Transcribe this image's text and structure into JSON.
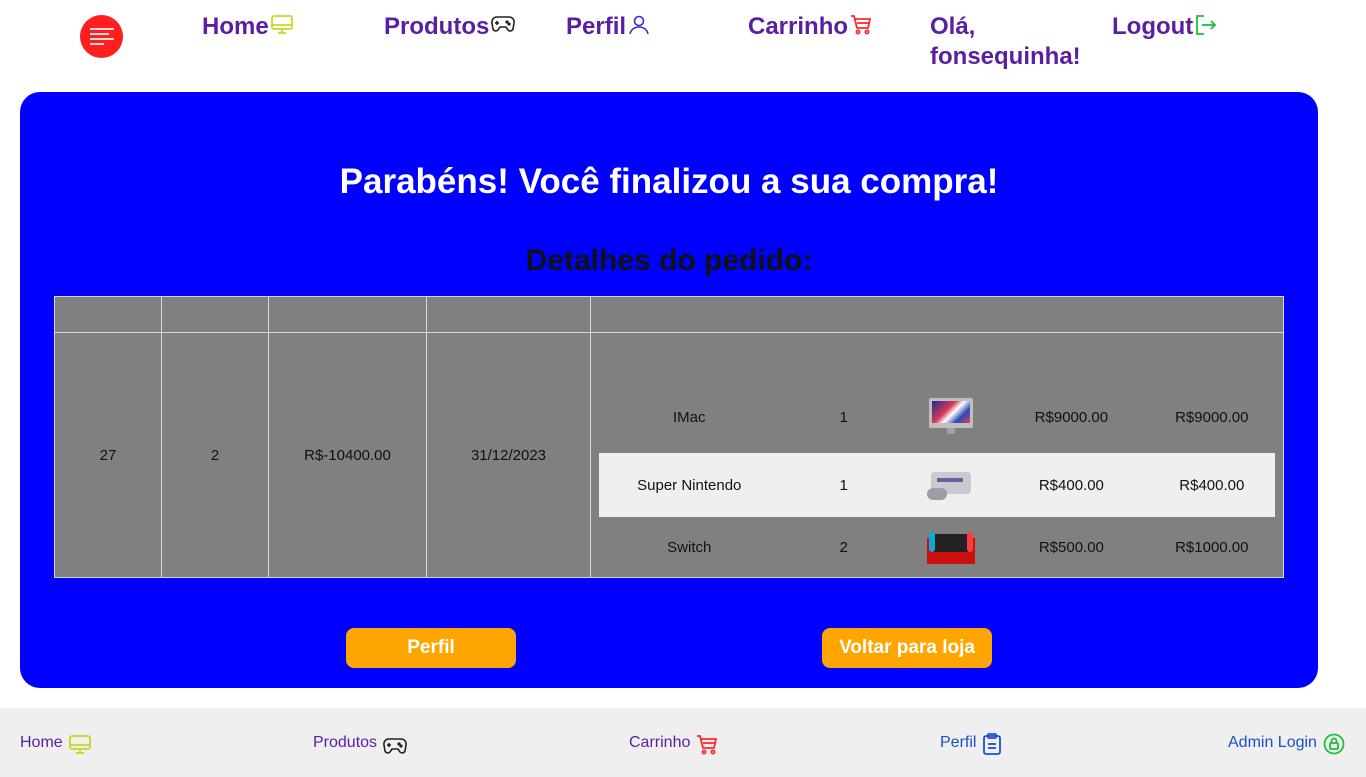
{
  "colors": {
    "nav_text": "#5a1ea3",
    "card_bg": "#0000ff",
    "button_bg": "#ffa500",
    "table_bg": "#808080",
    "footer_bg": "#efefef",
    "monitor_icon": "#c8d820",
    "cart_icon": "#ff2a2a",
    "logout_icon": "#1fbf3a",
    "perfil_icon_footer": "#1a4fd0",
    "admin_icon": "#1fbf3a"
  },
  "nav": {
    "home": "Home",
    "produtos": "Produtos",
    "perfil": "Perfil",
    "carrinho": "Carrinho",
    "greeting": "Olá, fonsequinha!",
    "logout": "Logout",
    "icons": {
      "home": "monitor-icon",
      "produtos": "gamepad-icon",
      "perfil": "user-icon",
      "carrinho": "cart-icon",
      "logout": "logout-icon"
    }
  },
  "main": {
    "success_title": "Parabéns! Você finalizou a sua compra!",
    "details_title": "Detalhes do pedido:",
    "order": {
      "id": "27",
      "count": "2",
      "total": "R$-10400.00",
      "date": "31/12/2023",
      "items": [
        {
          "name": "IMac",
          "qty": "1",
          "image": "imac-image",
          "price": "R$9000.00",
          "subtotal": "R$9000.00"
        },
        {
          "name": "Super Nintendo",
          "qty": "1",
          "image": "super-nintendo-image",
          "price": "R$400.00",
          "subtotal": "R$400.00"
        },
        {
          "name": "Switch",
          "qty": "2",
          "image": "switch-image",
          "price": "R$500.00",
          "subtotal": "R$1000.00"
        }
      ]
    },
    "buttons": {
      "perfil": "Perfil",
      "voltar": "Voltar para loja"
    }
  },
  "footer": {
    "home": "Home",
    "produtos": "Produtos",
    "carrinho": "Carrinho",
    "perfil": "Perfil",
    "admin": "Admin Login",
    "icons": {
      "home": "monitor-icon",
      "produtos": "gamepad-icon",
      "carrinho": "cart-icon",
      "perfil": "clipboard-icon",
      "admin": "lock-icon"
    }
  }
}
